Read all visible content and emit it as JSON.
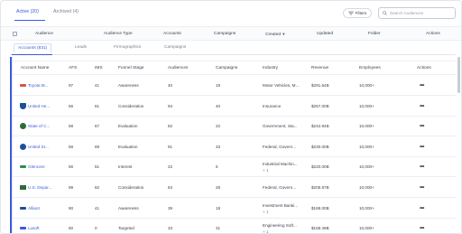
{
  "top_tabs": [
    {
      "label": "Active (20)",
      "active": true
    },
    {
      "label": "Archived (4)",
      "active": false
    }
  ],
  "filters_label": "Filters",
  "search_placeholder": "Search Audiences",
  "audience_columns": [
    "Audience",
    "Audience Type",
    "Accounts",
    "Campaigns",
    "Created",
    "Updated",
    "Folder",
    "Actions"
  ],
  "sub_tabs": [
    {
      "label": "Accounts (831)",
      "active": true
    },
    {
      "label": "Leads",
      "active": false
    },
    {
      "label": "Firmographics",
      "active": false
    },
    {
      "label": "Campaigns",
      "active": false
    }
  ],
  "account_columns": [
    "Account Name",
    "AFS",
    "IMS",
    "Funnel Stage",
    "Audiences",
    "Campaigns",
    "Industry",
    "Revenue",
    "Employees",
    "Actions"
  ],
  "rows": [
    {
      "name": "Toyota M...",
      "afs": "97",
      "ims": "41",
      "stage": "Awareness",
      "audiences": "40",
      "campaigns": "19",
      "industry": "Motor Vehicles, M...",
      "industry_extra": "",
      "revenue": "$291.64B",
      "employees": "10,000+",
      "logo_color": "#d9534f",
      "logo_shape": "bar"
    },
    {
      "name": "United He...",
      "afs": "56",
      "ims": "81",
      "stage": "Consideration",
      "audiences": "94",
      "campaigns": "40",
      "industry": "Insurance",
      "industry_extra": "",
      "revenue": "$257.00B",
      "employees": "10,000+",
      "logo_color": "#1f4f9c",
      "logo_shape": "shield"
    },
    {
      "name": "State of C...",
      "afs": "58",
      "ims": "67",
      "stage": "Evaluation",
      "audiences": "82",
      "campaigns": "22",
      "industry": "Government, Sta...",
      "industry_extra": "",
      "revenue": "$242.94B",
      "employees": "10,000+",
      "logo_color": "#2f6b3a",
      "logo_shape": "circle"
    },
    {
      "name": "United St...",
      "afs": "58",
      "ims": "69",
      "stage": "Evaluation",
      "audiences": "91",
      "campaigns": "33",
      "industry": "Federal, Govern...",
      "industry_extra": "",
      "revenue": "$230.00B",
      "employees": "10,000+",
      "logo_color": "#1f4f9c",
      "logo_shape": "circle"
    },
    {
      "name": "Glencore",
      "afs": "56",
      "ims": "51",
      "stage": "Interest",
      "audiences": "22",
      "campaigns": "5",
      "industry": "Industrial Machin...",
      "industry_extra": "+ 1",
      "revenue": "$220.00B",
      "employees": "10,000+",
      "logo_color": "#2e8b57",
      "logo_shape": "bar"
    },
    {
      "name": "U.S. Depar...",
      "afs": "99",
      "ims": "82",
      "stage": "Consideration",
      "audiences": "84",
      "campaigns": "28",
      "industry": "Federal, Govern...",
      "industry_extra": "",
      "revenue": "$205.97B",
      "employees": "10,000+",
      "logo_color": "#2e6b3a",
      "logo_shape": "flag"
    },
    {
      "name": "Allianz",
      "afs": "90",
      "ims": "41",
      "stage": "Awareness",
      "audiences": "39",
      "campaigns": "18",
      "industry": "Investment Banki...",
      "industry_extra": "+ 1",
      "revenue": "$188.00B",
      "employees": "10,000+",
      "logo_color": "#1f4f9c",
      "logo_shape": "bar"
    },
    {
      "name": "Lusoft",
      "afs": "60",
      "ims": "0",
      "stage": "Targeted",
      "audiences": "33",
      "campaigns": "31",
      "industry": "Engineering Soft...",
      "industry_extra": "+ 1",
      "revenue": "$158.49B",
      "employees": "10,000+",
      "logo_color": "#3b5bdb",
      "logo_shape": "bar"
    }
  ],
  "colors": {
    "accent": "#3b5bdb",
    "border": "#e3e5ea",
    "text": "#3a3f4b",
    "muted": "#7a8090"
  }
}
